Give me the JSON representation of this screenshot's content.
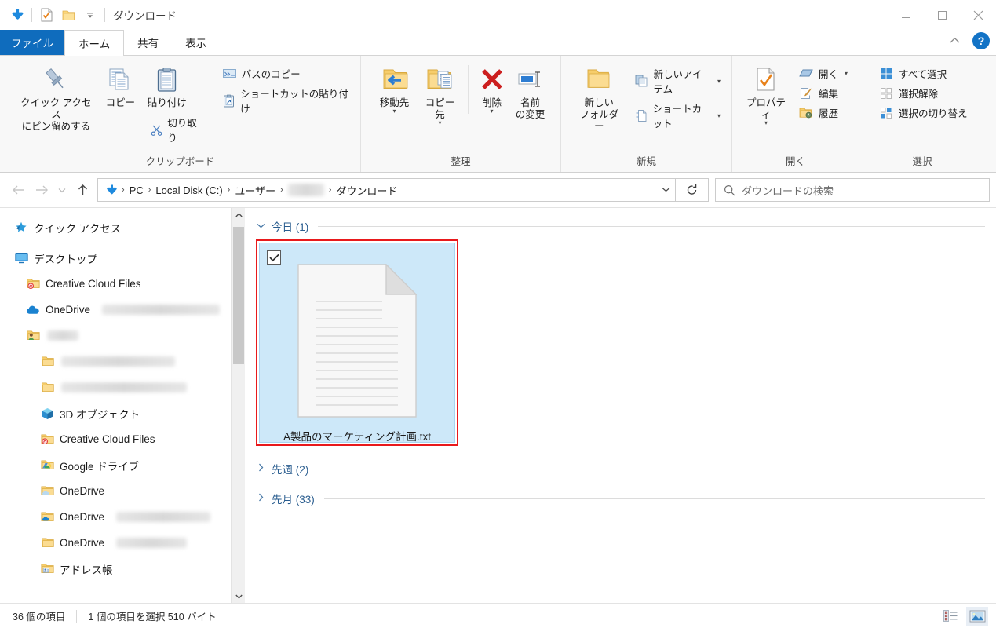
{
  "window": {
    "title": "ダウンロード",
    "quick_access_icons": [
      "download-arrow-icon",
      "properties-icon",
      "new-folder-icon",
      "customize-qat-dropdown-icon"
    ],
    "controls": {
      "minimize": "minimize-button",
      "maximize": "maximize-button",
      "close": "close-button",
      "close_glyph": "✕"
    }
  },
  "tabs": [
    {
      "label": "ファイル",
      "type": "file"
    },
    {
      "label": "ホーム",
      "type": "active"
    },
    {
      "label": "共有",
      "type": "plain"
    },
    {
      "label": "表示",
      "type": "plain"
    }
  ],
  "ribbon": {
    "collapse_chevron": "︿",
    "help_label": "?",
    "groups": [
      {
        "title": "クリップボード",
        "big_buttons": [
          {
            "label_line1": "クイック アクセス",
            "label_line2": "にピン留めする",
            "icon": "pin-icon"
          },
          {
            "label_line1": "コピー",
            "label_line2": "",
            "icon": "copy-icon"
          },
          {
            "label_line1": "貼り付け",
            "label_line2": "",
            "icon": "paste-icon"
          }
        ],
        "small_buttons": [
          {
            "label": "パスのコピー",
            "icon": "copy-path-icon",
            "dropdown": false
          },
          {
            "label": "ショートカットの貼り付け",
            "icon": "paste-shortcut-icon",
            "dropdown": false
          },
          {
            "label": "切り取り",
            "icon": "scissors-icon",
            "dropdown": false
          }
        ]
      },
      {
        "title": "整理",
        "big_buttons": [
          {
            "label_line1": "移動先",
            "label_line2": "",
            "icon": "move-to-icon",
            "dropdown": true
          },
          {
            "label_line1": "コピー先",
            "label_line2": "",
            "icon": "copy-to-icon",
            "dropdown": true
          },
          {
            "label_line1": "削除",
            "label_line2": "",
            "icon": "delete-icon",
            "dropdown": true
          },
          {
            "label_line1": "名前",
            "label_line2": "の変更",
            "icon": "rename-icon",
            "dropdown": false
          }
        ]
      },
      {
        "title": "新規",
        "big_buttons": [
          {
            "label_line1": "新しい",
            "label_line2": "フォルダー",
            "icon": "new-folder-icon",
            "dropdown": false
          }
        ],
        "small_buttons": [
          {
            "label": "新しいアイテム",
            "icon": "new-item-icon",
            "dropdown": true
          },
          {
            "label": "ショートカット",
            "icon": "shortcut-icon",
            "dropdown": true
          }
        ]
      },
      {
        "title": "開く",
        "big_buttons": [
          {
            "label_line1": "プロパティ",
            "label_line2": "",
            "icon": "properties-icon",
            "dropdown": true
          }
        ],
        "small_buttons": [
          {
            "label": "開く",
            "icon": "open-icon",
            "dropdown": true
          },
          {
            "label": "編集",
            "icon": "edit-icon",
            "dropdown": false
          },
          {
            "label": "履歴",
            "icon": "history-icon",
            "dropdown": false
          }
        ]
      },
      {
        "title": "選択",
        "small_buttons": [
          {
            "label": "すべて選択",
            "icon": "select-all-icon",
            "dropdown": false
          },
          {
            "label": "選択解除",
            "icon": "select-none-icon",
            "dropdown": false
          },
          {
            "label": "選択の切り替え",
            "icon": "invert-selection-icon",
            "dropdown": false
          }
        ]
      }
    ]
  },
  "addressbar": {
    "back_icon": "back-arrow-icon",
    "forward_icon": "forward-arrow-icon",
    "recent_icon": "recent-locations-chevron-icon",
    "up_icon": "up-arrow-icon",
    "path_icon": "download-arrow-icon",
    "breadcrumbs": [
      "PC",
      "Local Disk (C:)",
      "ユーザー",
      "",
      "ダウンロード"
    ],
    "separator": "›",
    "dropdown_icon": "chevron-down-icon",
    "refresh_icon": "refresh-icon",
    "search": {
      "placeholder": "ダウンロードの検索",
      "icon": "search-icon",
      "value": ""
    }
  },
  "sidebar": {
    "items": [
      {
        "label": "クイック アクセス",
        "icon": "star-quick-access-icon",
        "indent": 0,
        "blurred": false
      },
      {
        "label": "デスクトップ",
        "icon": "desktop-icon",
        "indent": 0,
        "blurred": false
      },
      {
        "label": "Creative Cloud Files",
        "icon": "creative-cloud-folder-icon",
        "indent": 1,
        "blurred": false
      },
      {
        "label": "OneDrive",
        "icon": "onedrive-cloud-icon",
        "indent": 1,
        "blurred": true,
        "blur_width": 150
      },
      {
        "label": "",
        "icon": "user-folder-icon",
        "indent": 1,
        "blurred": true,
        "blur_width": 40
      },
      {
        "label": "",
        "icon": "folder-icon",
        "indent": 2,
        "blurred": true,
        "blur_width": 145
      },
      {
        "label": "",
        "icon": "folder-icon",
        "indent": 2,
        "blurred": true,
        "blur_width": 160
      },
      {
        "label": "3D オブジェクト",
        "icon": "3d-objects-icon",
        "indent": 2,
        "blurred": false
      },
      {
        "label": "Creative Cloud Files",
        "icon": "creative-cloud-folder-icon",
        "indent": 2,
        "blurred": false
      },
      {
        "label": "Google ドライブ",
        "icon": "google-drive-icon",
        "indent": 2,
        "blurred": false
      },
      {
        "label": "OneDrive",
        "icon": "onedrive-folder-icon",
        "indent": 2,
        "blurred": false
      },
      {
        "label": "OneDrive",
        "icon": "onedrive-folder-icon",
        "indent": 2,
        "blurred": true,
        "blur_width": 120
      },
      {
        "label": "OneDrive",
        "icon": "folder-icon",
        "indent": 2,
        "blurred": true,
        "blur_width": 90
      },
      {
        "label": "アドレス帳",
        "icon": "address-book-folder-icon",
        "indent": 2,
        "blurred": false
      }
    ],
    "scroll": {
      "up_icon": "scroll-up-arrow-icon",
      "down_icon": "scroll-down-arrow-icon"
    }
  },
  "content": {
    "groups": [
      {
        "label": "今日 (1)",
        "expanded": true,
        "chevron": "⌄"
      },
      {
        "label": "先週 (2)",
        "expanded": false,
        "chevron": "›"
      },
      {
        "label": "先月 (33)",
        "expanded": false,
        "chevron": "›"
      }
    ],
    "files": [
      {
        "name": "A製品のマーケティング計画.txt",
        "icon": "text-file-icon",
        "selected": true,
        "checked": true,
        "annotated": true,
        "annotation_color": "#e8191c"
      }
    ]
  },
  "statusbar": {
    "item_count": "36 個の項目",
    "selection_info": "1 個の項目を選択  510 バイト",
    "views": [
      {
        "name": "details-view-button",
        "active": false
      },
      {
        "name": "large-icons-view-button",
        "active": true
      }
    ]
  },
  "colors": {
    "file_tab_blue": "#0f6cbd",
    "selection_blue": "#cde8f9",
    "annotation_red": "#e8191c",
    "group_header_blue": "#2a5d8f",
    "accent_download": "#1e8ade"
  }
}
